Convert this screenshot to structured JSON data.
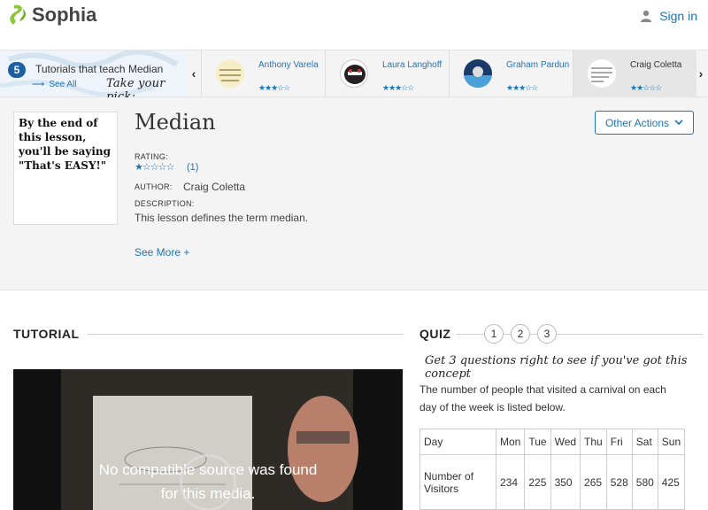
{
  "header": {
    "brand": "Sophia",
    "signin_label": "Sign in"
  },
  "tutorial_strip": {
    "count": "5",
    "title": "Tutorials that teach Median",
    "see_all": "See All",
    "pick_text": "Take your pick:",
    "tutors": [
      {
        "name": "Anthony Varela",
        "stars": "★★★☆☆"
      },
      {
        "name": "Laura Langhoff",
        "stars": "★★★☆☆"
      },
      {
        "name": "Graham Pardun",
        "stars": "★★★☆☆"
      },
      {
        "name": "Craig Coletta",
        "stars": "★★☆☆☆"
      }
    ]
  },
  "lesson": {
    "thumb_text": "By the end of this lesson, you'll be saying \"That's EASY!\"",
    "title": "Median",
    "rating_label": "RATING:",
    "rating_stars": "★☆☆☆☆",
    "rating_count": "(1)",
    "author_label": "AUTHOR:",
    "author": "Craig Coletta",
    "description_label": "DESCRIPTION:",
    "description": "This lesson defines the term median.",
    "see_more": "See More +",
    "other_actions": "Other Actions"
  },
  "tutorial_section": {
    "heading": "TUTORIAL",
    "video_message_1": "No compatible source was found",
    "video_message_2": "for this media."
  },
  "quiz": {
    "heading": "QUIZ",
    "numbers": [
      "1",
      "2",
      "3"
    ],
    "tagline": "Get 3 questions right to see if you've got this concept",
    "question": "The number of people that visited a carnival on each day of the week is listed below.",
    "table": {
      "headers": [
        "Day",
        "Mon",
        "Tue",
        "Wed",
        "Thu",
        "Fri",
        "Sat",
        "Sun"
      ],
      "row_label": "Number of Visitors",
      "values": [
        "234",
        "225",
        "350",
        "265",
        "528",
        "580",
        "425"
      ]
    }
  },
  "colors": {
    "accent": "#1d74b7",
    "strip_bg": "#f4f4f4"
  }
}
